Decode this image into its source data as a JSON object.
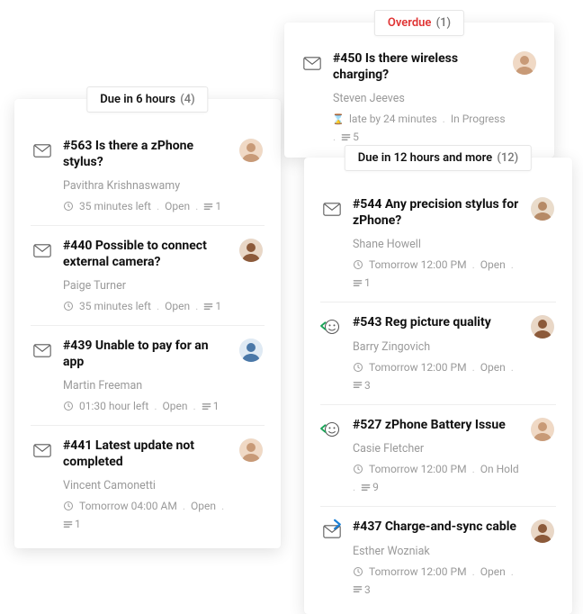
{
  "cards": {
    "due6": {
      "title": "Due in 6 hours",
      "count": "(4)",
      "tickets": [
        {
          "channel": "email",
          "id": "#563",
          "subject": "Is there a zPhone stylus?",
          "requester": "Pavithra Krishnaswamy",
          "time": "35 minutes left",
          "status": "Open",
          "conv": "1",
          "avatar": "f-tan"
        },
        {
          "channel": "email",
          "id": "#440",
          "subject": "Possible to connect external camera?",
          "requester": "Paige Turner",
          "time": "35 minutes left",
          "status": "Open",
          "conv": "1",
          "avatar": "f-brown"
        },
        {
          "channel": "email",
          "id": "#439",
          "subject": "Unable to pay for an app",
          "requester": "Martin Freeman",
          "time": "01:30 hour left",
          "status": "Open",
          "conv": "1",
          "avatar": "m-blue"
        },
        {
          "channel": "email",
          "id": "#441",
          "subject": "Latest update not completed",
          "requester": "Vincent Camonetti",
          "time": "Tomorrow 04:00 AM",
          "status": "Open",
          "conv": "1",
          "avatar": "f-tan"
        }
      ]
    },
    "overdue": {
      "title": "Overdue",
      "count": "(1)",
      "tickets": [
        {
          "channel": "email",
          "id": "#450",
          "subject": "Is there wireless charging?",
          "requester": "Steven Jeeves",
          "late": "late by 24 minutes",
          "status": "In Progress",
          "conv": "5",
          "avatar": "f-tan"
        }
      ]
    },
    "due12": {
      "title": "Due in 12 hours and more",
      "count": "(12)",
      "tickets": [
        {
          "channel": "email",
          "id": "#544",
          "subject": "Any precision stylus for zPhone?",
          "requester": "Shane Howell",
          "time": "Tomorrow 12:00 PM",
          "status": "Open",
          "conv": "1",
          "avatar": "m-tan"
        },
        {
          "channel": "reply-chat",
          "id": "#543",
          "subject": "Reg picture quality",
          "requester": "Barry Zingovich",
          "time": "Tomorrow 12:00 PM",
          "status": "Open",
          "conv": "3",
          "avatar": "f-brown"
        },
        {
          "channel": "reply-chat",
          "id": "#527",
          "subject": "zPhone Battery Issue",
          "requester": "Casie Fletcher",
          "time": "Tomorrow 12:00 PM",
          "status": "On Hold",
          "conv": "9",
          "avatar": "f-tan"
        },
        {
          "channel": "email-sent",
          "id": "#437",
          "subject": "Charge-and-sync cable",
          "requester": "Esther Wozniak",
          "time": "Tomorrow 12:00 PM",
          "status": "Open",
          "conv": "3",
          "avatar": "f-brown"
        }
      ]
    }
  }
}
